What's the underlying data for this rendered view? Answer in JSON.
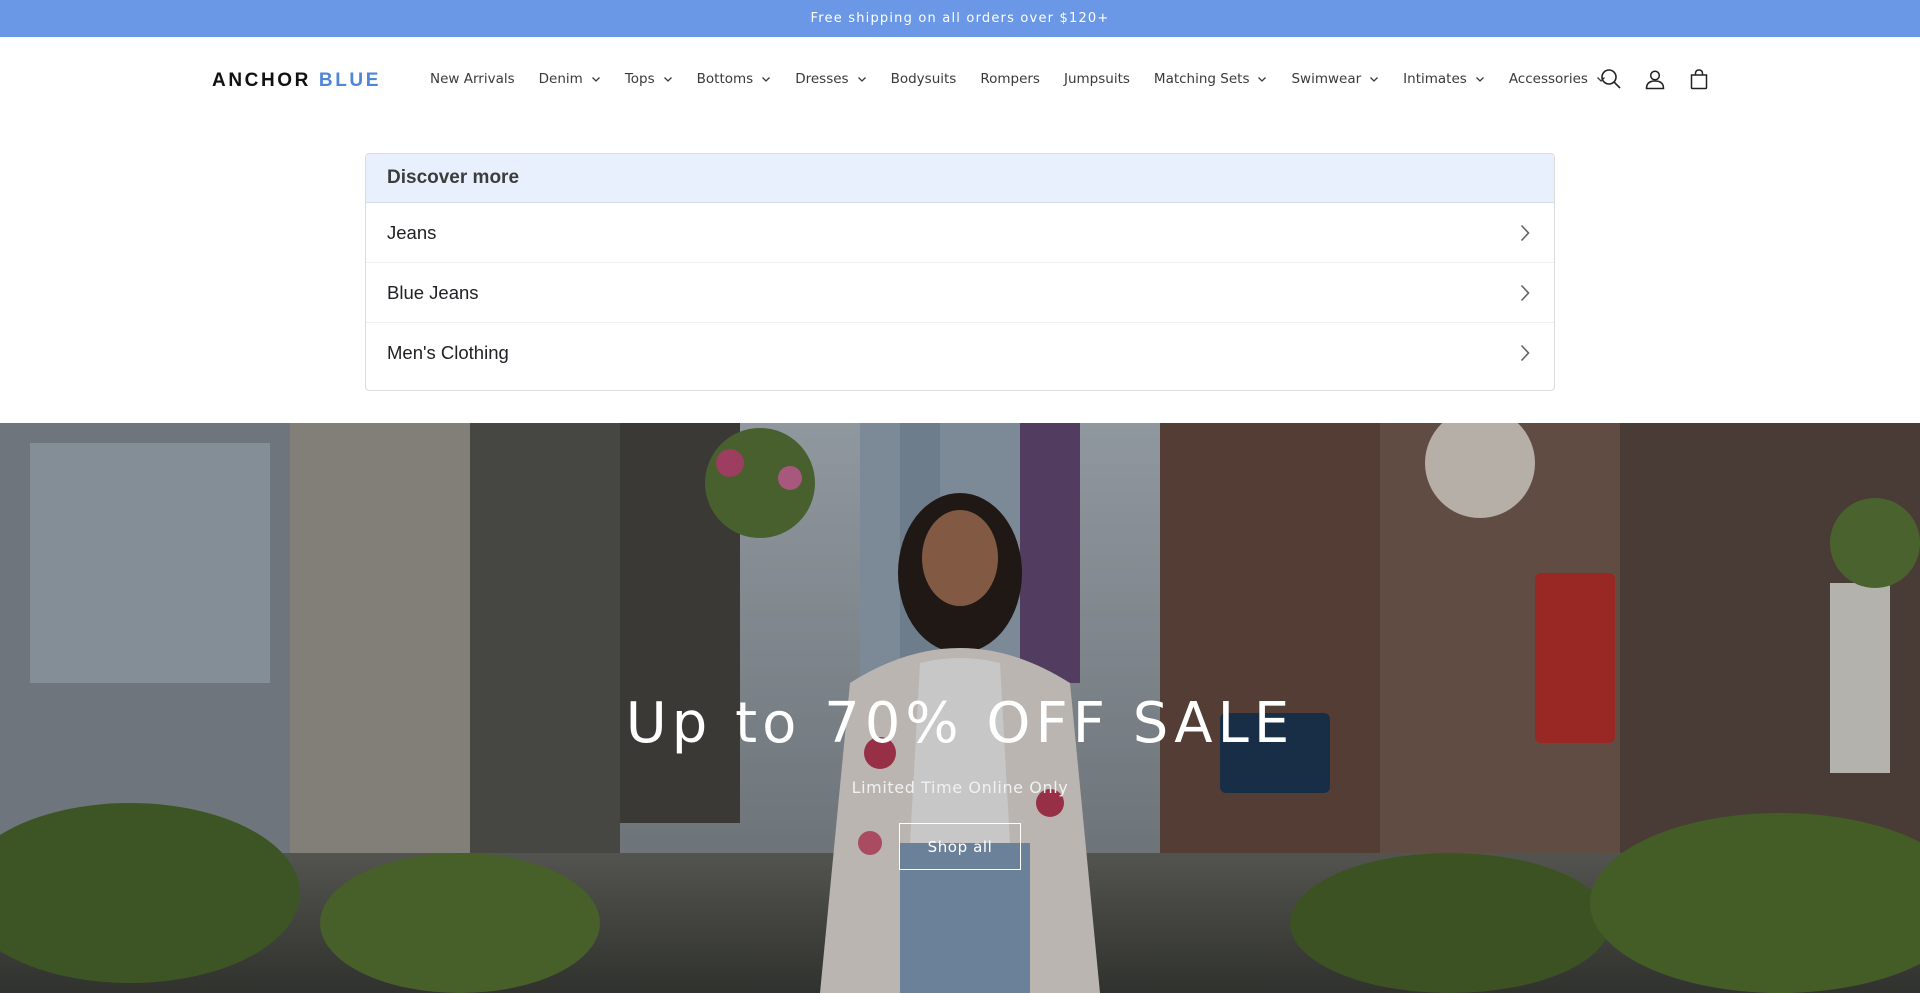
{
  "announcement": {
    "text": "Free shipping on all orders over $120+"
  },
  "header": {
    "logo_part1": "ANCHOR",
    "logo_part2": "BLUE",
    "nav": [
      {
        "label": "New Arrivals",
        "dropdown": false
      },
      {
        "label": "Denim",
        "dropdown": true
      },
      {
        "label": "Tops",
        "dropdown": true
      },
      {
        "label": "Bottoms",
        "dropdown": true
      },
      {
        "label": "Dresses",
        "dropdown": true
      },
      {
        "label": "Bodysuits",
        "dropdown": false
      },
      {
        "label": "Rompers",
        "dropdown": false
      },
      {
        "label": "Jumpsuits",
        "dropdown": false
      },
      {
        "label": "Matching Sets",
        "dropdown": true
      },
      {
        "label": "Swimwear",
        "dropdown": true
      },
      {
        "label": "Intimates",
        "dropdown": true
      },
      {
        "label": "Accessories",
        "dropdown": true
      }
    ],
    "icons": [
      "search-icon",
      "account-icon",
      "cart-icon"
    ]
  },
  "discover": {
    "title": "Discover more",
    "items": [
      {
        "label": "Jeans"
      },
      {
        "label": "Blue Jeans"
      },
      {
        "label": "Men's Clothing"
      }
    ]
  },
  "hero": {
    "title": "Up to 70% OFF SALE",
    "subtitle": "Limited Time Online Only",
    "button_label": "Shop all"
  },
  "colors": {
    "announcement_bg": "#6a97e6",
    "logo_accent": "#4f86d6",
    "discover_header_bg": "#e8f0fd"
  }
}
